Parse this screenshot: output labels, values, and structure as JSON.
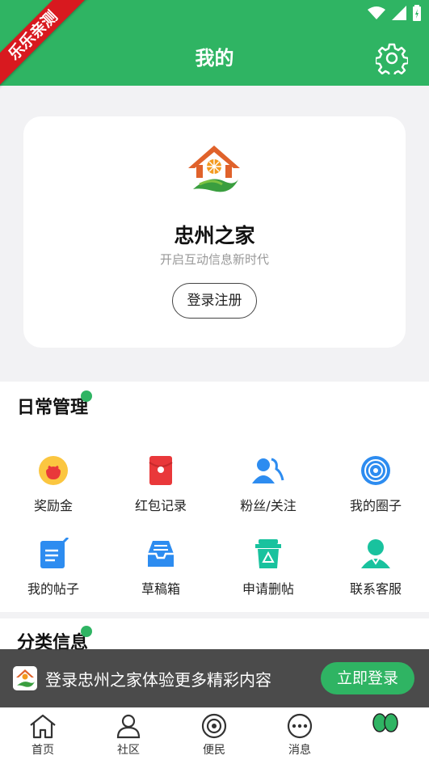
{
  "header": {
    "title": "我的",
    "ribbon": "乐乐亲测"
  },
  "profile": {
    "app_name": "忠州之家",
    "slogan": "开启互动信息新时代",
    "login_label": "登录注册"
  },
  "daily": {
    "title": "日常管理",
    "items": [
      {
        "label": "奖励金",
        "icon": "reward-bag-icon"
      },
      {
        "label": "红包记录",
        "icon": "red-envelope-icon"
      },
      {
        "label": "粉丝/关注",
        "icon": "fans-icon"
      },
      {
        "label": "我的圈子",
        "icon": "circle-target-icon"
      },
      {
        "label": "我的帖子",
        "icon": "post-edit-icon"
      },
      {
        "label": "草稿箱",
        "icon": "draft-box-icon"
      },
      {
        "label": "申请删帖",
        "icon": "delete-bin-icon"
      },
      {
        "label": "联系客服",
        "icon": "customer-service-icon"
      }
    ]
  },
  "category": {
    "title": "分类信息"
  },
  "banner": {
    "text": "登录忠州之家体验更多精彩内容",
    "button": "立即登录"
  },
  "nav": [
    {
      "label": "首页",
      "icon": "home-icon"
    },
    {
      "label": "社区",
      "icon": "community-icon"
    },
    {
      "label": "便民",
      "icon": "convenience-icon"
    },
    {
      "label": "消息",
      "icon": "message-icon"
    },
    {
      "label": "",
      "icon": "mine-icon"
    }
  ],
  "colors": {
    "brand": "#2fb463",
    "red": "#e9383a",
    "blue": "#2d8cf0",
    "teal": "#19c29e"
  }
}
